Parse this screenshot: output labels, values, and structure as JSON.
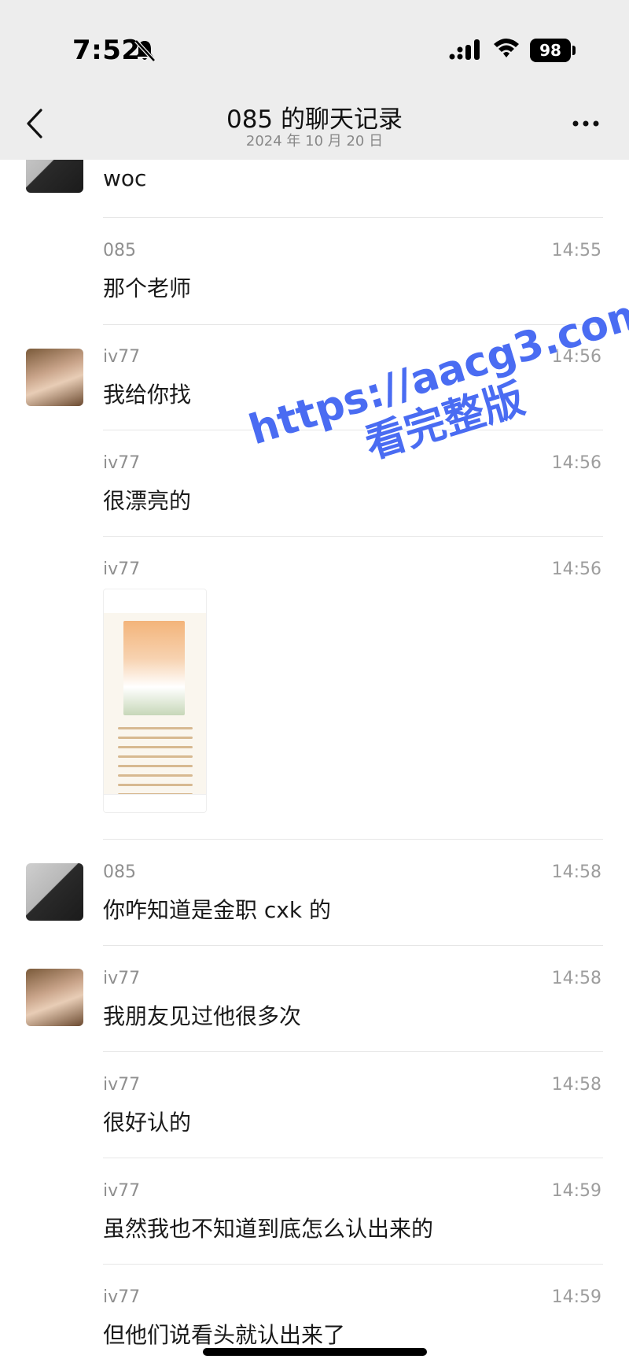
{
  "status_bar": {
    "time": "7:52",
    "battery": "98"
  },
  "header": {
    "title": "085 的聊天记录",
    "subtitle": "2024 年 10 月 20 日"
  },
  "watermark": {
    "line1": "https://aacg3.com",
    "line2": "看完整版"
  },
  "messages": [
    {
      "sender": "",
      "time": "",
      "text": "woc"
    },
    {
      "sender": "085",
      "time": "14:55",
      "text": "那个老师"
    },
    {
      "sender": "iv77",
      "time": "14:56",
      "text": "我给你找"
    },
    {
      "sender": "iv77",
      "time": "14:56",
      "text": "很漂亮的"
    },
    {
      "sender": "iv77",
      "time": "14:56",
      "text": ""
    },
    {
      "sender": "085",
      "time": "14:58",
      "text": "你咋知道是金职 cxk 的"
    },
    {
      "sender": "iv77",
      "time": "14:58",
      "text": "我朋友见过他很多次"
    },
    {
      "sender": "iv77",
      "time": "14:58",
      "text": "很好认的"
    },
    {
      "sender": "iv77",
      "time": "14:59",
      "text": "虽然我也不知道到底怎么认出来的"
    },
    {
      "sender": "iv77",
      "time": "14:59",
      "text": "但他们说看头就认出来了"
    }
  ],
  "icons": {
    "back": "chevron-left-icon",
    "more": "more-dots-icon",
    "bell": "bell-muted-icon",
    "signal": "cellular-signal-icon",
    "wifi": "wifi-icon"
  }
}
